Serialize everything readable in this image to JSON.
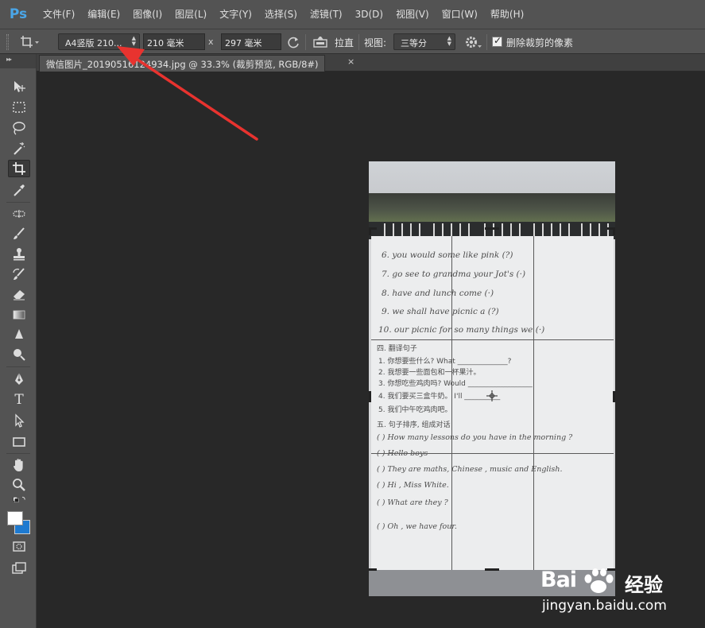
{
  "app": {
    "logo": "Ps"
  },
  "menu": [
    "文件(F)",
    "编辑(E)",
    "图像(I)",
    "图层(L)",
    "文字(Y)",
    "选择(S)",
    "滤镜(T)",
    "3D(D)",
    "视图(V)",
    "窗口(W)",
    "帮助(H)"
  ],
  "options": {
    "preset": "A4竖版 210...",
    "width": "210 毫米",
    "times": "x",
    "height": "297 毫米",
    "straighten": "拉直",
    "view_label": "视图:",
    "view_value": "三等分",
    "delete_checked": true,
    "delete_label": "删除裁剪的像素"
  },
  "document": {
    "tab_title": "微信图片_20190516124934.jpg @ 33.3% (裁剪预览, RGB/8#)",
    "close": "×"
  },
  "toolbox": {
    "tools": [
      "move-tool",
      "marquee-tool",
      "lasso-tool",
      "magic-wand-tool",
      "crop-tool",
      "eyedropper-tool",
      "healing-brush-tool",
      "brush-tool",
      "clone-stamp-tool",
      "history-brush-tool",
      "eraser-tool",
      "gradient-tool",
      "blur-tool",
      "dodge-tool",
      "pen-tool",
      "type-tool",
      "path-selection-tool",
      "rectangle-tool",
      "hand-tool",
      "zoom-tool"
    ],
    "active": "crop-tool",
    "type_glyph": "T"
  },
  "photo_text": {
    "lines_en": [
      "6. you   would   some   like  pink  (?)",
      "7.  go   see   to   grandma   your   Jot's (·)",
      "8.  have   and   lunch   come  (·)",
      "9.  we   shall   have   picnic   a   (?)",
      "10.  our   picnic   for   so  many   things  we (·)"
    ],
    "section4": "四. 翻译句子",
    "cn_lines": [
      "1. 你想要些什么?   What ______________?",
      "2. 我想要一些面包和一杯果汁。",
      "3. 你想吃些鸡肉吗?  Would __________________",
      "4. 我们要买三盒牛奶。  I'll __________",
      "5. 我们中午吃鸡肉吧。"
    ],
    "section5": "五. 句子排序, 组成对话",
    "dialogue": [
      "(    )  How  many lessons do you  have  in  the morning ?",
      "(    )  Hello  boys",
      "(    )  They  are  maths, Chinese , music  and  English.",
      "(    )  Hi ,  Miss  White.",
      "(    )  What  are  they ?",
      "(    )  Oh , we  have  four."
    ]
  },
  "watermark": {
    "brand": "Bai",
    "brand_suffix": "经验",
    "url": "jingyan.baidu.com"
  }
}
